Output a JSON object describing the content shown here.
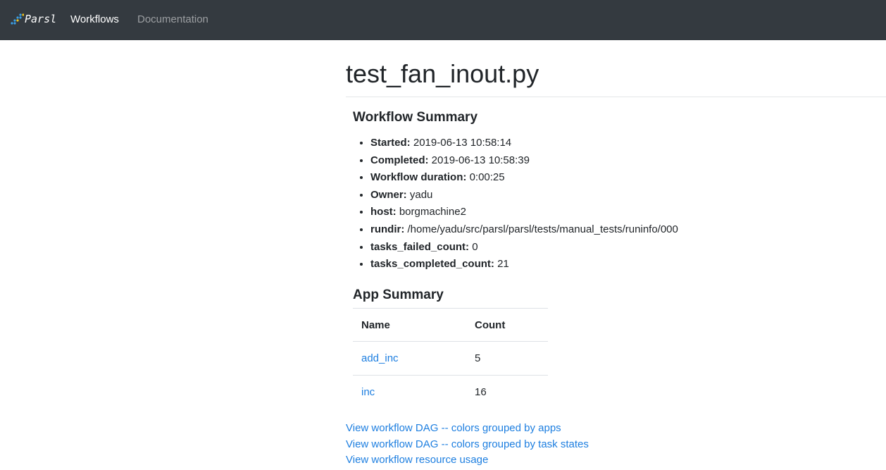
{
  "navbar": {
    "brand": "Parsl",
    "links": [
      {
        "label": "Workflows"
      },
      {
        "label": "Documentation"
      }
    ]
  },
  "page": {
    "title": "test_fan_inout.py"
  },
  "workflow_summary": {
    "heading": "Workflow Summary",
    "items": [
      {
        "key": "Started:",
        "value": "2019-06-13 10:58:14"
      },
      {
        "key": "Completed:",
        "value": "2019-06-13 10:58:39"
      },
      {
        "key": "Workflow duration:",
        "value": "0:00:25"
      },
      {
        "key": "Owner:",
        "value": "yadu"
      },
      {
        "key": "host:",
        "value": "borgmachine2"
      },
      {
        "key": "rundir:",
        "value": "/home/yadu/src/parsl/parsl/tests/manual_tests/runinfo/000"
      },
      {
        "key": "tasks_failed_count:",
        "value": "0"
      },
      {
        "key": "tasks_completed_count:",
        "value": "21"
      }
    ]
  },
  "app_summary": {
    "heading": "App Summary",
    "columns": [
      "Name",
      "Count"
    ],
    "rows": [
      {
        "name": "add_inc",
        "count": "5"
      },
      {
        "name": "inc",
        "count": "16"
      }
    ]
  },
  "links": [
    {
      "label": "View workflow DAG -- colors grouped by apps"
    },
    {
      "label": "View workflow DAG -- colors grouped by task states"
    },
    {
      "label": "View workflow resource usage"
    }
  ],
  "colors": {
    "navbar_bg": "#343a40",
    "link": "#1e7fe0",
    "text": "#212529"
  }
}
